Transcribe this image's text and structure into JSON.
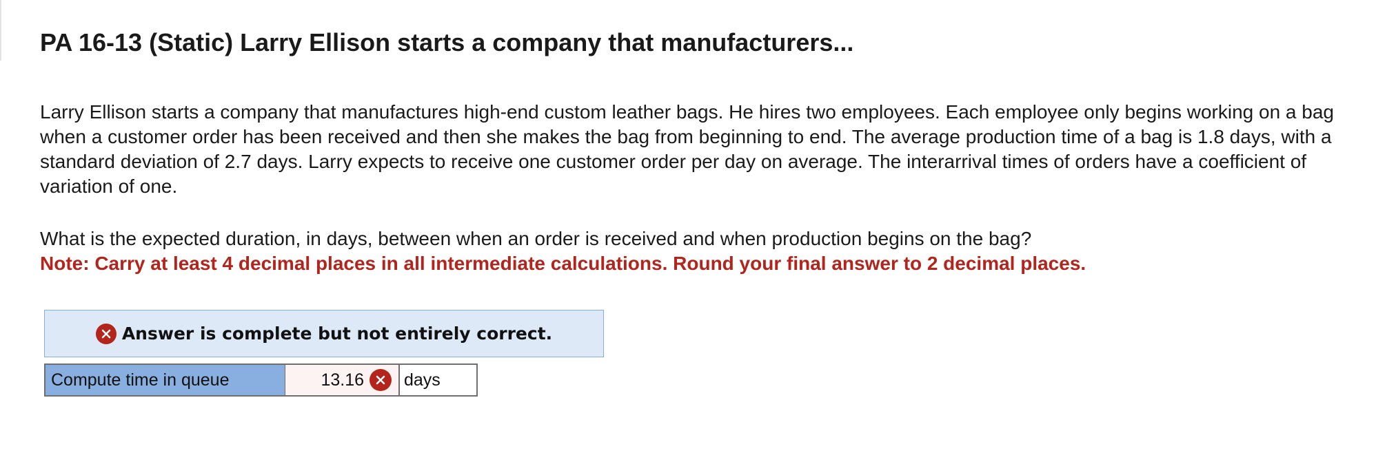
{
  "question": {
    "title": "PA 16-13 (Static) Larry Ellison starts a company that manufacturers...",
    "problem_text": "Larry Ellison starts a company that manufactures high-end custom leather bags. He hires two employees. Each employee only begins working on a bag when a customer order has been received and then she makes the bag from beginning to end. The average production time of a bag is 1.8 days, with a standard deviation of 2.7 days. Larry expects to receive one customer order per day on average. The interarrival times of orders have a coefficient of variation of one.",
    "prompt": "What is the expected duration, in days, between when an order is received and when production begins on the bag?",
    "note": "Note: Carry at least 4 decimal places in all intermediate calculations. Round your final answer to 2 decimal places."
  },
  "feedback": {
    "message": "Answer is complete but not entirely correct.",
    "icon": "incorrect-x-icon",
    "color": "#b2241c",
    "banner_bg": "#dde9f7"
  },
  "answer": {
    "label": "Compute time in queue",
    "value": "13.16",
    "unit": "days",
    "status": "incorrect",
    "label_bg": "#89aee0"
  }
}
